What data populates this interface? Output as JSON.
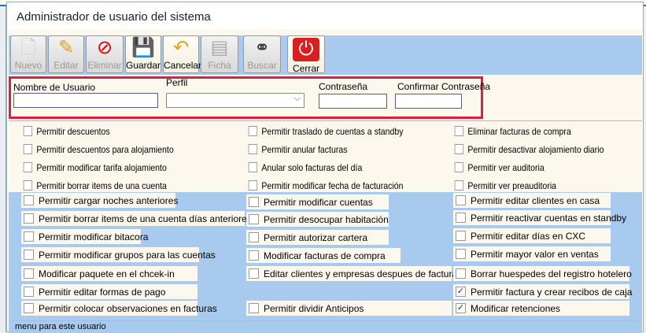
{
  "window": {
    "title": "Administrador de usuario del sistema"
  },
  "toolbar": [
    {
      "label": "Nuevo",
      "icon": "new-document-icon",
      "enabled": false
    },
    {
      "label": "Editar",
      "icon": "pencil-icon",
      "enabled": false
    },
    {
      "label": "Eliminar",
      "icon": "delete-icon",
      "enabled": false
    },
    {
      "label": "Guardar",
      "icon": "floppy-disk-icon",
      "enabled": true
    },
    {
      "label": "Cancelar",
      "icon": "undo-arrow-icon",
      "enabled": true
    },
    {
      "label": "Ficha",
      "icon": "form-icon",
      "enabled": false
    },
    {
      "label": "Buscar",
      "icon": "binoculars-icon",
      "enabled": false
    },
    {
      "label": "Cerrar",
      "icon": "power-icon",
      "enabled": true
    }
  ],
  "form": {
    "username_label": "Nombre de Usuario",
    "username_value": "",
    "profile_label": "Perfil",
    "profile_value": "",
    "password_label": "Contraseña",
    "confirm_label": "Confirmar Contraseña"
  },
  "permissions_top": [
    [
      "Permitir descuentos",
      "Permitir traslado de cuentas a standby",
      "Eliminar facturas de compra"
    ],
    [
      "Permitir descuentos para alojamiento",
      "Permitir anular facturas",
      "Permitir desactivar alojamiento diario"
    ],
    [
      "Permitir modificar tarifa alojamiento",
      "Anular solo facturas del día",
      "Permitir ver auditoria"
    ],
    [
      "Permitir borrar items de una cuenta",
      "Permitir modificar fecha de facturación",
      "Permitir ver preauditoria"
    ]
  ],
  "permissions_bottom": {
    "col1": [
      "Permitir cargar noches anteriores",
      "Permitir borrar items de una cuenta días anteriores",
      "Permitir modificar bitacora",
      "Permitir modificar grupos para las cuentas",
      "Modificar paquete en el chcek-in",
      "Permitir editar formas de pago",
      "Permitir colocar observaciones en facturas"
    ],
    "col2": [
      "Permitir modificar cuentas",
      "Permitir desocupar habitación",
      "Permitir autorizar cartera",
      "Modificar facturas de compra",
      "Editar clientes y empresas despues de facturadas",
      "Permitir dividir Anticipos"
    ],
    "col3": [
      "Permitir editar clientes en casa",
      "Permitir reactivar cuentas en standby",
      "Permitir editar días en CXC",
      "Permitir mayor valor en ventas",
      "Borrar huespedes del registro hotelero",
      "Permitir factura y crear recibos de caja",
      "Modificar retenciones"
    ],
    "col3_checked": [
      false,
      false,
      false,
      false,
      false,
      true,
      true
    ]
  },
  "footer": {
    "label": "menu para este usuario"
  },
  "checkmark": "✓"
}
